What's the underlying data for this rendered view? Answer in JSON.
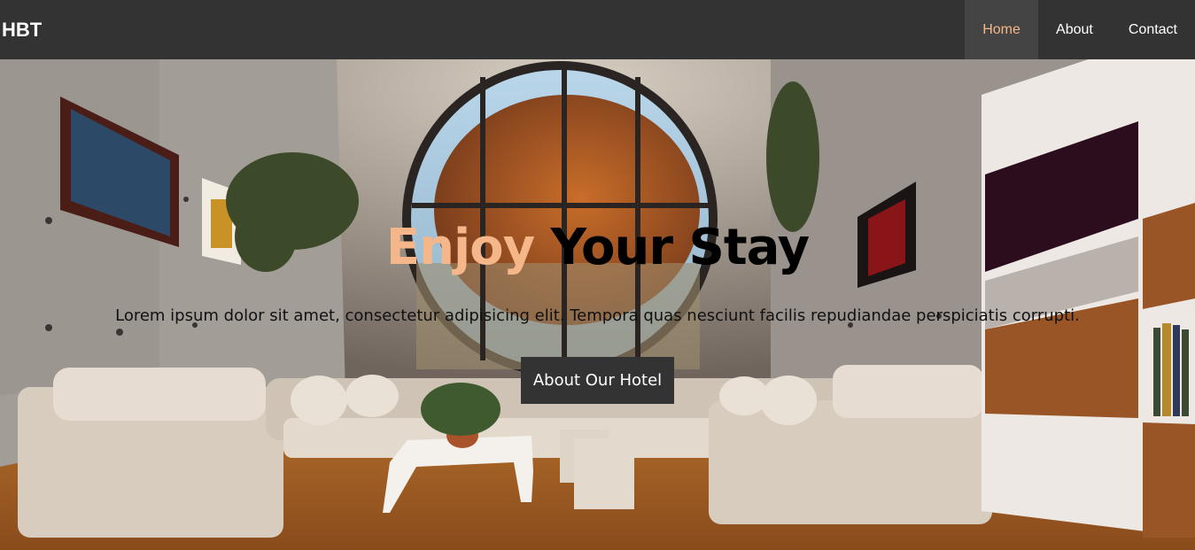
{
  "navbar": {
    "brand": "HBT",
    "links": [
      {
        "label": "Home",
        "active": true
      },
      {
        "label": "About",
        "active": false
      },
      {
        "label": "Contact",
        "active": false
      }
    ]
  },
  "hero": {
    "title_accent": "Enjoy",
    "title_rest": " Your Stay",
    "description": "Lorem ipsum dolor sit amet, consectetur adipisicing elit. Tempora quas nesciunt facilis repudiandae perspiciatis corrupti.",
    "button_label": "About Our Hotel"
  },
  "colors": {
    "navbar_bg": "#333333",
    "active_link_bg": "#444444",
    "accent": "#f5b78a",
    "button_bg": "#333333"
  }
}
